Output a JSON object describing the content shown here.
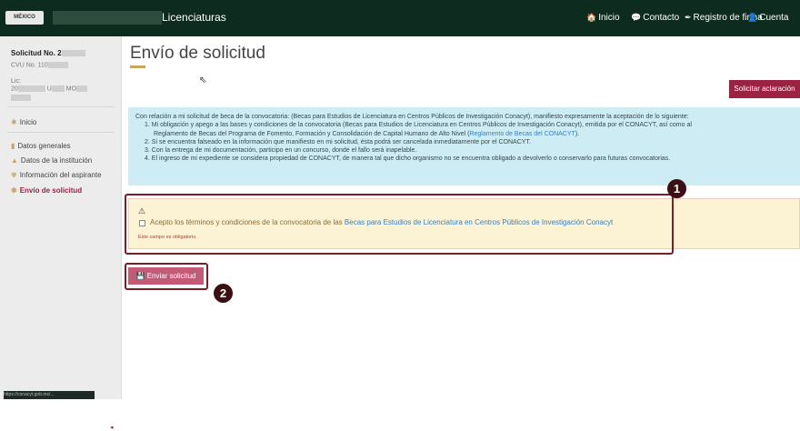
{
  "topbar": {
    "logo_text": "MÉXICO",
    "brand": "Licenciaturas",
    "nav": [
      {
        "icon": "home-icon",
        "glyph": "🏠",
        "label": "Inicio"
      },
      {
        "icon": "chat-icon",
        "glyph": "💬",
        "label": "Contacto"
      },
      {
        "icon": "signature-icon",
        "glyph": "✒",
        "label": "Registro de firma"
      },
      {
        "icon": "user-icon",
        "glyph": "👤",
        "label": "Cuenta"
      }
    ]
  },
  "sidebar": {
    "solicitud_label": "Solicitud No. 2",
    "cvu_label": "CVU No. 110",
    "lic_label": "Lic:",
    "lic_line_prefix": "20",
    "lic_line_mid1": "U",
    "lic_line_mid2": "MO",
    "items": [
      {
        "label": "Inicio",
        "glyph": "✱",
        "active": false
      },
      {
        "label": "Datos generales",
        "glyph": "▮",
        "active": false
      },
      {
        "label": "Datos de la institución",
        "glyph": "▲",
        "active": false
      },
      {
        "label": "Información del aspirante",
        "glyph": "✾",
        "active": false
      },
      {
        "label": "Envío de solicitud",
        "glyph": "✱",
        "active": true
      }
    ],
    "status_url": "https://conacyt.gob.mx/..."
  },
  "main": {
    "title": "Envío de solicitud",
    "solicitar_button": "Solicitar aclaración",
    "info": {
      "intro": "Con relación a mi solicitud de beca de la convocatoria: (Becas para Estudios de Licenciatura en Centros Públicos de Investigación Conacyt), manifiesto expresamente la aceptación de lo siguiente:",
      "item1_a": "1. Mi obligación y apego a las bases y condiciones de la convocatoria (Becas para Estudios de Licenciatura en Centros Públicos de Investigación Conacyt), emitida por el CONACYT, así como al",
      "item1_b": "Reglamento de Becas del Programa de Fomento, Formación y Consolidación de Capital Humano de Alto Nivel (",
      "item1_link": "Reglamento de Becas del CONACYT",
      "item1_c": ").",
      "item2": "2. Si se encuentra falseado en la información que manifiesto en mi solicitud, ésta podrá ser cancelada inmediatamente por el CONACYT.",
      "item3": "3. Con la entrega de mi documentación, participo en un concurso, donde el fallo será inapelable.",
      "item4": "4. El ingreso de mi expediente se considera propiedad de CONACYT, de manera tal que dicho organismo no se encuentra obligado a devolverlo o conservarlo para futuras convocatorias."
    },
    "terms": {
      "warning_glyph": "⚠",
      "text_prefix": "Acepto los términos y condiciones de la convocatoria de las ",
      "link": "Becas para Estudios de Licenciatura en Centros Públicos de Investigación Conacyt",
      "required": "Este campo es obligatorio.",
      "checked": false
    },
    "send_button": "Enviar solicitud",
    "send_icon": "💾"
  },
  "markers": [
    "1",
    "2"
  ],
  "colors": {
    "topbar": "#0e2b1f",
    "accent": "#9b2242",
    "gold": "#c9a55a",
    "info_bg": "#cdecf3",
    "warning_bg": "#fbf3d4"
  }
}
